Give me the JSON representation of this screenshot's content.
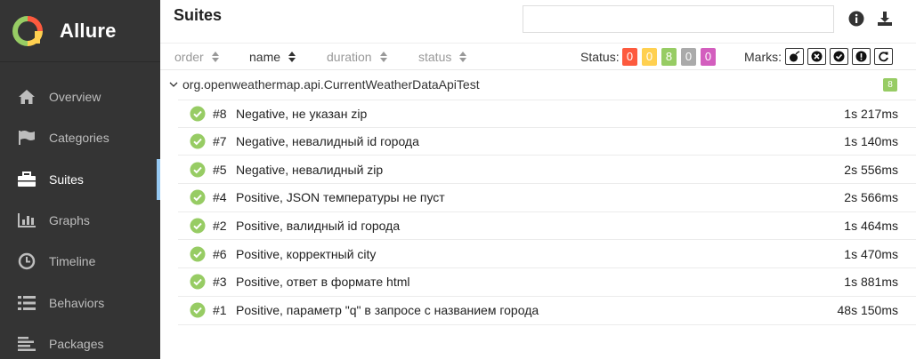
{
  "brand": {
    "name": "Allure"
  },
  "nav": [
    {
      "label": "Overview",
      "icon": "home-icon"
    },
    {
      "label": "Categories",
      "icon": "flag-icon"
    },
    {
      "label": "Suites",
      "icon": "briefcase-icon",
      "active": true
    },
    {
      "label": "Graphs",
      "icon": "bar-chart-icon"
    },
    {
      "label": "Timeline",
      "icon": "clock-icon"
    },
    {
      "label": "Behaviors",
      "icon": "list-icon"
    },
    {
      "label": "Packages",
      "icon": "align-left-icon"
    }
  ],
  "header": {
    "title": "Suites",
    "search_placeholder": ""
  },
  "sort": {
    "order": "order",
    "name": "name",
    "duration": "duration",
    "status": "status"
  },
  "status_filter": {
    "label": "Status:",
    "counts": [
      {
        "value": "0",
        "color": "#fd5a3e"
      },
      {
        "value": "0",
        "color": "#ffd050"
      },
      {
        "value": "8",
        "color": "#97cc64"
      },
      {
        "value": "0",
        "color": "#aaaaaa"
      },
      {
        "value": "0",
        "color": "#d35ebe"
      }
    ]
  },
  "marks": {
    "label": "Marks:",
    "icons": [
      "bomb-icon",
      "times-circle-icon",
      "check-circle-icon",
      "exclamation-circle-icon",
      "refresh-icon"
    ]
  },
  "group": {
    "name": "org.openweathermap.api.CurrentWeatherDataApiTest",
    "count": "8"
  },
  "tests": [
    {
      "num": "#8",
      "name": "Negative, не указан zip",
      "duration": "1s 217ms"
    },
    {
      "num": "#7",
      "name": "Negative, невалидный id города",
      "duration": "1s 140ms"
    },
    {
      "num": "#5",
      "name": "Negative, невалидный zip",
      "duration": "2s 556ms"
    },
    {
      "num": "#4",
      "name": "Positive, JSON температуры не пуст",
      "duration": "2s 566ms"
    },
    {
      "num": "#2",
      "name": "Positive, валидный id города",
      "duration": "1s 464ms"
    },
    {
      "num": "#6",
      "name": "Positive, корректный city",
      "duration": "1s 470ms"
    },
    {
      "num": "#3",
      "name": "Positive, ответ в формате html",
      "duration": "1s 881ms"
    },
    {
      "num": "#1",
      "name": "Positive, параметр \"q\" в запросе с названием города",
      "duration": "48s 150ms"
    }
  ]
}
